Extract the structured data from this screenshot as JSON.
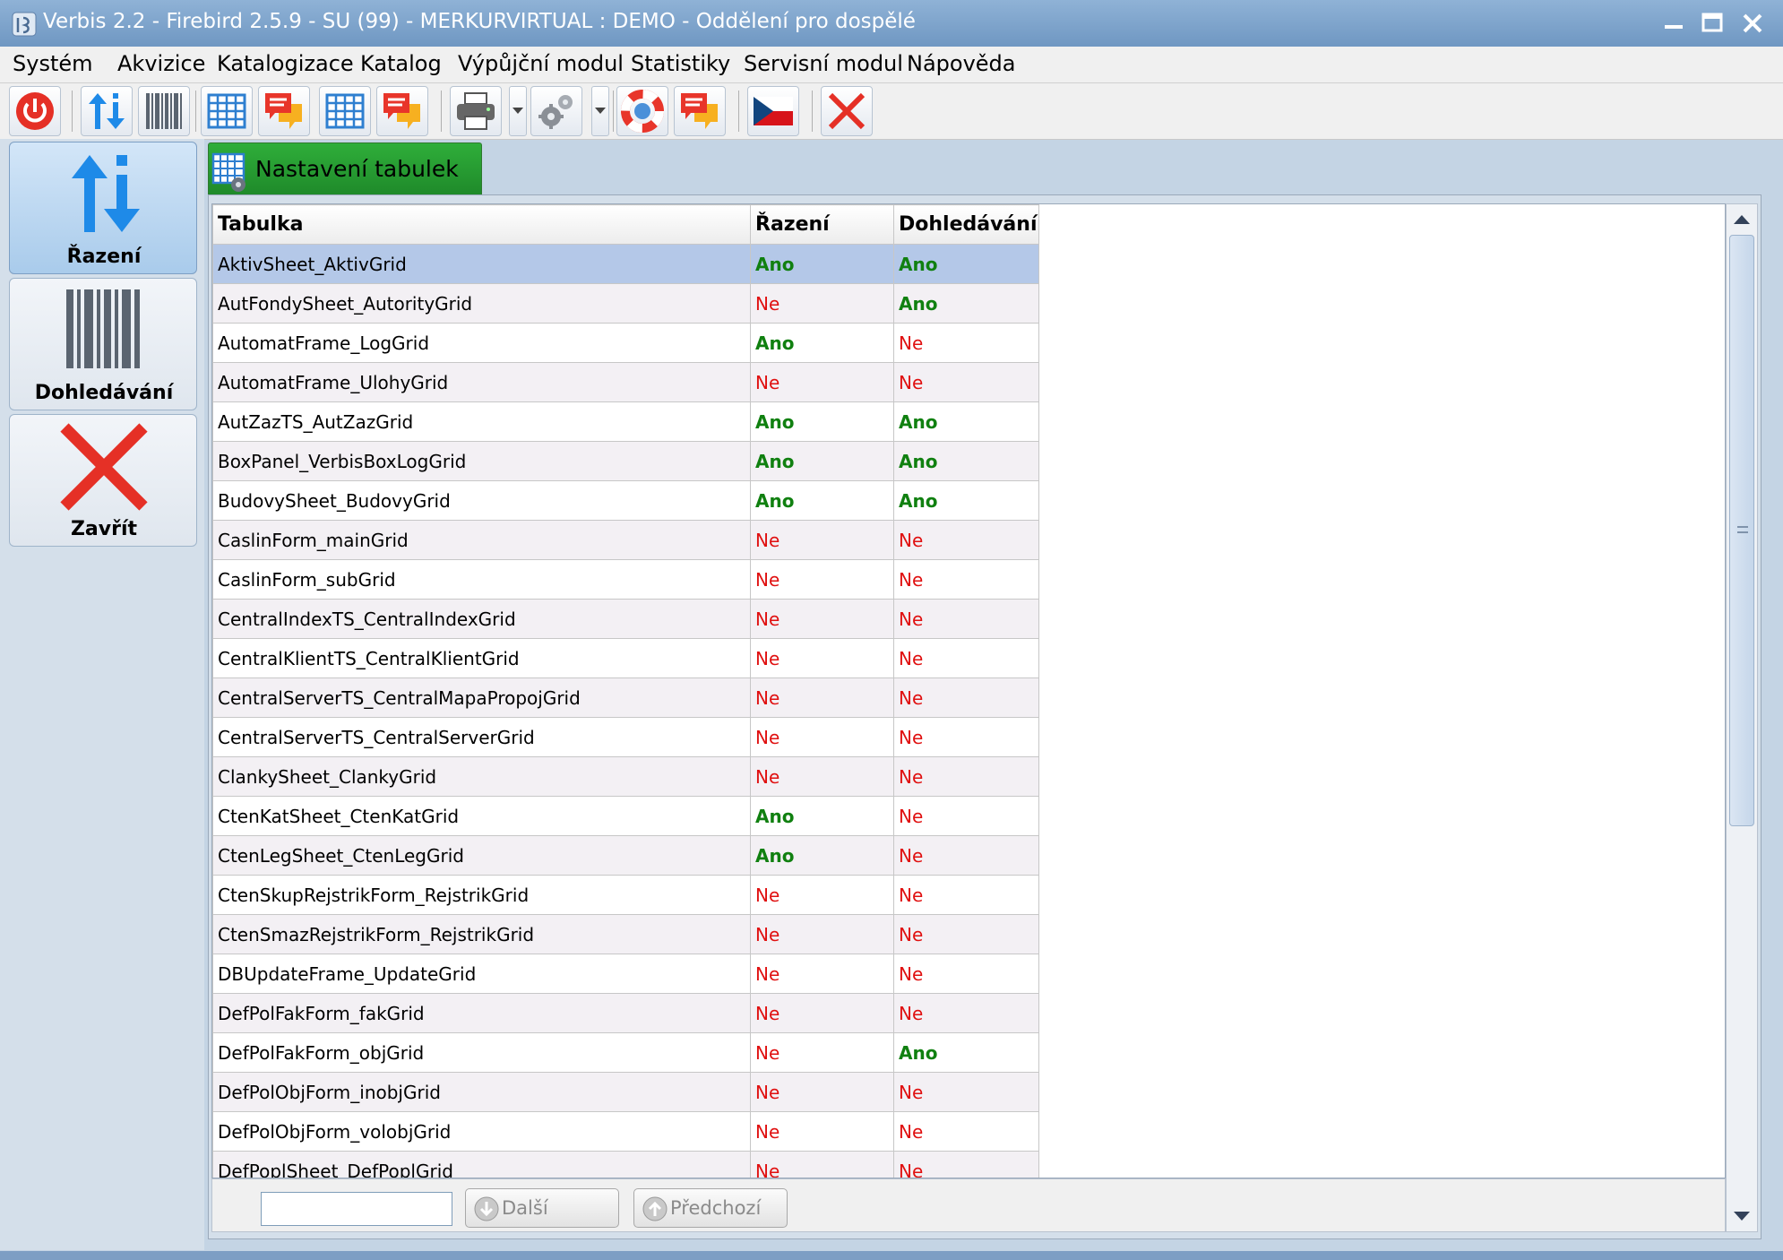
{
  "window": {
    "title": "Verbis 2.2 - Firebird 2.5.9 - SU (99) - MERKURVIRTUAL : DEMO - Oddělení pro dospělé"
  },
  "menu": [
    "Systém",
    "Akvizice",
    "Katalogizace",
    "Katalog",
    "Výpůjční modul",
    "Statistiky",
    "Servisní modul",
    "Nápověda"
  ],
  "toolbar": {
    "icons": [
      "power-icon",
      "sort-arrows-icon",
      "barcode-icon",
      "grid-icon",
      "chat-bubbles-icon",
      "grid-icon",
      "chat-bubbles-icon",
      "printer-icon",
      "gears-icon",
      "lifebuoy-icon",
      "chat-bubbles-icon",
      "czech-flag-icon",
      "close-icon"
    ]
  },
  "side": {
    "sort_label": "Řazení",
    "lookup_label": "Dohledávání",
    "close_label": "Zavřít"
  },
  "tab": {
    "label": "Nastavení tabulek"
  },
  "grid": {
    "headers": [
      "Tabulka",
      "Řazení",
      "Dohledávání"
    ],
    "rows": [
      [
        "AktivSheet_AktivGrid",
        "Ano",
        "Ano"
      ],
      [
        "AutFondySheet_AutorityGrid",
        "Ne",
        "Ano"
      ],
      [
        "AutomatFrame_LogGrid",
        "Ano",
        "Ne"
      ],
      [
        "AutomatFrame_UlohyGrid",
        "Ne",
        "Ne"
      ],
      [
        "AutZazTS_AutZazGrid",
        "Ano",
        "Ano"
      ],
      [
        "BoxPanel_VerbisBoxLogGrid",
        "Ano",
        "Ano"
      ],
      [
        "BudovySheet_BudovyGrid",
        "Ano",
        "Ano"
      ],
      [
        "CaslinForm_mainGrid",
        "Ne",
        "Ne"
      ],
      [
        "CaslinForm_subGrid",
        "Ne",
        "Ne"
      ],
      [
        "CentralIndexTS_CentralIndexGrid",
        "Ne",
        "Ne"
      ],
      [
        "CentralKlientTS_CentralKlientGrid",
        "Ne",
        "Ne"
      ],
      [
        "CentralServerTS_CentralMapaPropojGrid",
        "Ne",
        "Ne"
      ],
      [
        "CentralServerTS_CentralServerGrid",
        "Ne",
        "Ne"
      ],
      [
        "ClankySheet_ClankyGrid",
        "Ne",
        "Ne"
      ],
      [
        "CtenKatSheet_CtenKatGrid",
        "Ano",
        "Ne"
      ],
      [
        "CtenLegSheet_CtenLegGrid",
        "Ano",
        "Ne"
      ],
      [
        "CtenSkupRejstrikForm_RejstrikGrid",
        "Ne",
        "Ne"
      ],
      [
        "CtenSmazRejstrikForm_RejstrikGrid",
        "Ne",
        "Ne"
      ],
      [
        "DBUpdateFrame_UpdateGrid",
        "Ne",
        "Ne"
      ],
      [
        "DefPolFakForm_fakGrid",
        "Ne",
        "Ne"
      ],
      [
        "DefPolFakForm_objGrid",
        "Ne",
        "Ano"
      ],
      [
        "DefPolObjForm_inobjGrid",
        "Ne",
        "Ne"
      ],
      [
        "DefPolObjForm_volobjGrid",
        "Ne",
        "Ne"
      ],
      [
        "DefPoplSheet_DefPoplGrid",
        "Ne",
        "Ne"
      ]
    ],
    "selected_row": 0
  },
  "search": {
    "value": "",
    "next_label": "Další",
    "prev_label": "Předchozí"
  },
  "colors": {
    "yes": "#108010",
    "no": "#e01010",
    "tab_green": "#1f8a2a",
    "selection": "#b4c8e8"
  }
}
